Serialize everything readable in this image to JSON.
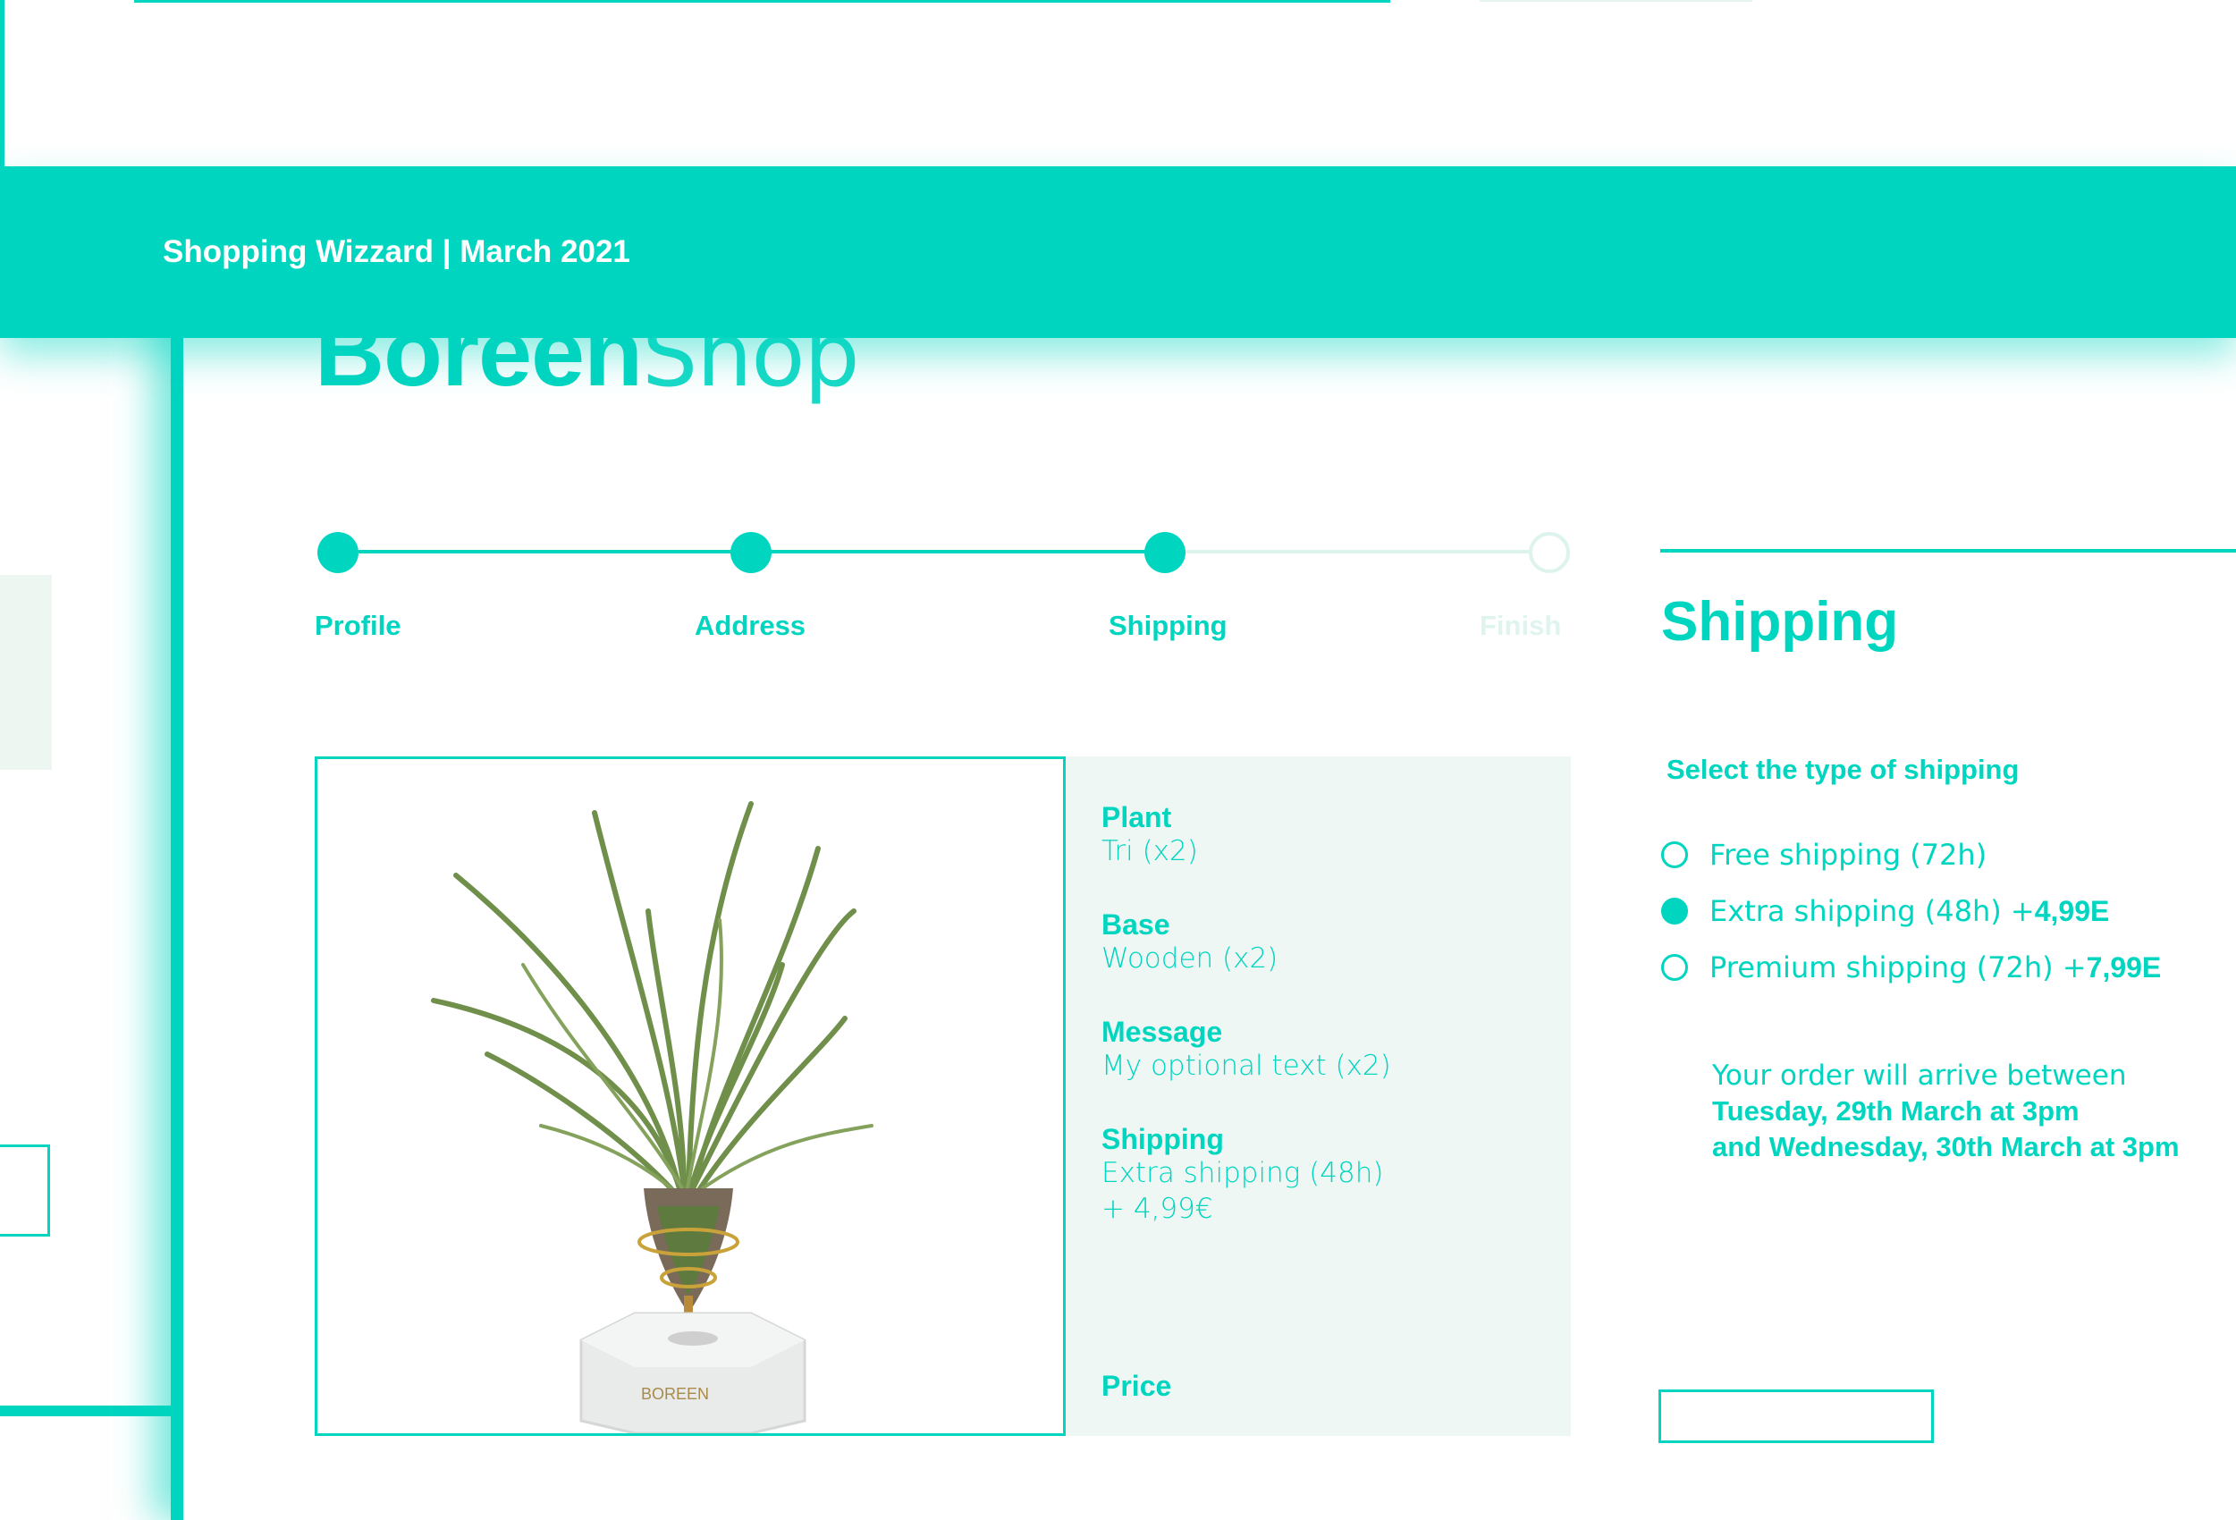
{
  "header": {
    "title": "Shopping Wizzard | March 2021"
  },
  "logo": {
    "bold": "Boreen",
    "light": "Shop"
  },
  "stepper": {
    "steps": [
      {
        "label": "Profile",
        "done": true
      },
      {
        "label": "Address",
        "done": true
      },
      {
        "label": "Shipping",
        "done": true
      },
      {
        "label": "Finish",
        "done": false
      }
    ]
  },
  "product": {
    "image_icon": "air-plant-photo",
    "base_brand": "BOREEN",
    "details": [
      {
        "label": "Plant",
        "value": "Tri (x2)"
      },
      {
        "label": "Base",
        "value": "Wooden (x2)"
      },
      {
        "label": "Message",
        "value": "My optional text (x2)"
      },
      {
        "label": "Shipping",
        "value": "Extra shipping (48h)",
        "value2": "+ 4,99€"
      }
    ],
    "price_label": "Price"
  },
  "shipping": {
    "title": "Shipping",
    "subtitle": "Select the type of shipping",
    "options": [
      {
        "label": "Free shipping (72h)",
        "price": "",
        "checked": false
      },
      {
        "label": "Extra shipping (48h) + ",
        "price": "4,99E",
        "checked": true
      },
      {
        "label": "Premium shipping (72h) + ",
        "price": "7,99E",
        "checked": false
      }
    ],
    "arrival_intro": "Your order will arrive between",
    "arrival_from": "Tuesday, 29th March at 3pm",
    "arrival_to": "and Wednesday, 30th March at 3pm"
  },
  "colors": {
    "accent": "#00d5c0",
    "panel": "#eef7f3",
    "inactive": "#ddf3ee"
  }
}
